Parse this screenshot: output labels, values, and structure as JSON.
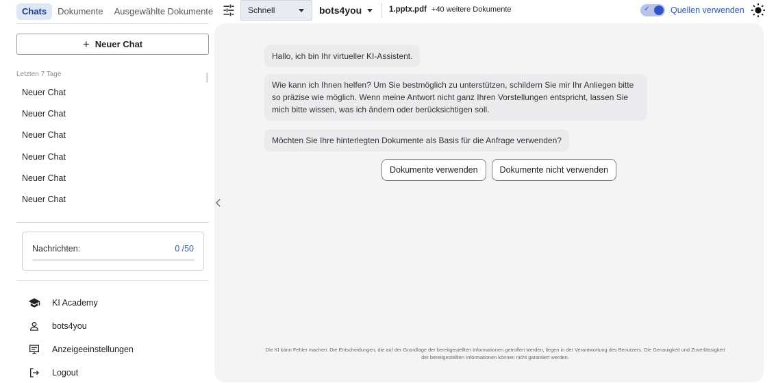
{
  "sidebar": {
    "tabs": [
      {
        "label": "Chats",
        "active": true
      },
      {
        "label": "Dokumente",
        "active": false
      },
      {
        "label": "Ausgewählte Dokumente",
        "active": false
      }
    ],
    "new_chat_label": "Neuer Chat",
    "section_label": "Letzten 7 Tage",
    "chats": [
      "Neuer Chat",
      "Neuer Chat",
      "Neuer Chat",
      "Neuer Chat",
      "Neuer Chat",
      "Neuer Chat"
    ],
    "usage": {
      "label": "Nachrichten:",
      "value_text": "0 /50",
      "used": 0,
      "limit": 50
    },
    "nav": [
      {
        "label": "KI Academy",
        "icon": "graduation-cap-icon"
      },
      {
        "label": "bots4you",
        "icon": "user-icon"
      },
      {
        "label": "Anzeigeeinstellungen",
        "icon": "display-settings-icon"
      },
      {
        "label": "Logout",
        "icon": "logout-icon"
      }
    ]
  },
  "toolbar": {
    "filter_icon": "tune-icon",
    "mode": "Schnell",
    "bot": "bots4you",
    "document_file": "1.pptx.pdf",
    "document_more": "+40 weitere Dokumente",
    "sources_toggle_on": true,
    "sources_label": "Quellen verwenden",
    "theme_icon": "sun-icon"
  },
  "chat": {
    "messages": [
      "Hallo, ich bin Ihr virtueller KI-Assistent.",
      "Wie kann ich Ihnen helfen? Um Sie bestmöglich zu unterstützen, schildern Sie mir Ihr Anliegen bitte so präzise wie möglich. Wenn meine Antwort nicht ganz Ihren Vorstellungen entspricht, lassen Sie mich bitte wissen, was ich ändern oder berücksichtigen soll.",
      "Möchten Sie Ihre hinterlegten Dokumente als Basis für die Anfrage verwenden?"
    ],
    "choices": [
      "Dokumente verwenden",
      "Dokumente nicht verwenden"
    ],
    "disclaimer": "Die KI kann Fehler machen. Die Entscheidungen, die auf der Grundlage der bereitgestellten Informationen getroffen werden, liegen in der Verantwortung des Benutzers. Die Genauigkeit und Zuverlässigkeit der bereitgestellten Informationen können nicht garantiert werden."
  },
  "colors": {
    "accent": "#2f55c8",
    "active_tab_bg": "#dfe7f7",
    "panel_bg": "#f4f4f4",
    "bubble_bg": "#ebebed"
  }
}
